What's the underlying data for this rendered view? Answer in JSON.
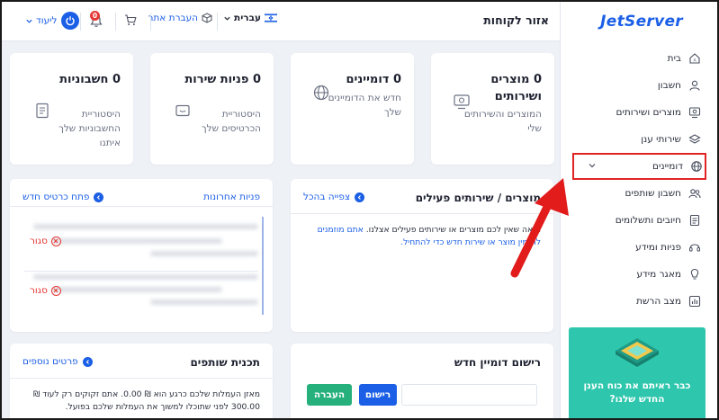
{
  "brand": {
    "logo": "JetServer",
    "accent": "#1b5fe6"
  },
  "header": {
    "title": "אזור לקוחות",
    "language": "עברית",
    "transfer": "העברת אתר",
    "notifications_count": "0",
    "user": "ליעוד"
  },
  "sidebar": {
    "items": [
      {
        "label": "בית",
        "icon": "home-icon"
      },
      {
        "label": "חשבון",
        "icon": "user-icon"
      },
      {
        "label": "מוצרים ושירותים",
        "icon": "products-icon"
      },
      {
        "label": "שירותי ענן",
        "icon": "cloud-icon"
      },
      {
        "label": "דומיינים",
        "icon": "globe-icon"
      },
      {
        "label": "חשבון שותפים",
        "icon": "partners-icon"
      },
      {
        "label": "חיובים ותשלומים",
        "icon": "billing-icon"
      },
      {
        "label": "פניות ומידע",
        "icon": "support-icon"
      },
      {
        "label": "מאגר מידע",
        "icon": "knowledge-icon"
      },
      {
        "label": "מצב הרשת",
        "icon": "network-icon"
      }
    ],
    "promo": "כבר ראיתם את כוח הענן החדש שלנו?"
  },
  "stats": [
    {
      "title": "0 מוצרים ושירותים",
      "sub": "המוצרים והשירותים שלי",
      "icon": "products-icon"
    },
    {
      "title": "0 דומיינים",
      "sub": "חדש את הדומיינים שלך",
      "icon": "globe-icon"
    },
    {
      "title": "0 פניות שירות",
      "sub": "היסטוריית הכרטיסים שלך",
      "icon": "ticket-icon"
    },
    {
      "title": "0 חשבוניות",
      "sub": "היסטוריית החשבוניות שלך איתנו",
      "icon": "invoice-icon"
    }
  ],
  "products_section": {
    "title": "מוצרים / שירותים פעילים",
    "link": "צפייה בהכל",
    "text": "נראה שאין לכם מוצרים או שירותים פעילים אצלנו.",
    "text_link": "אתם מוזמנים להזמין מוצר או שירות חדש כדי להתחיל."
  },
  "tickets_section": {
    "title": "פניות אחרונות",
    "link": "פתח כרטיס חדש",
    "tickets": [
      {
        "status": "סגור"
      },
      {
        "status": "סגור"
      }
    ]
  },
  "domain_section": {
    "title": "רישום דומיין חדש",
    "register": "רישום",
    "transfer": "העברה"
  },
  "affiliate_section": {
    "title": "תכנית שותפים",
    "link": "פרטים נוספים",
    "text": "מאזן העמלות שלכם כרגע הוא ₪ 0.00. אתם זקוקים רק לעוד ₪ 300.00 לפני שתוכלו למשוך את העמלות שלכם בפועל."
  }
}
